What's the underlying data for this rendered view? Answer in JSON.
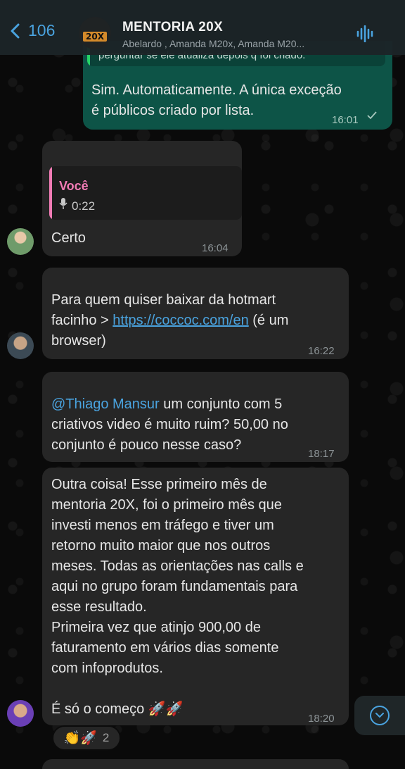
{
  "header": {
    "back_count": "106",
    "group_badge": "20X",
    "title": "MENTORIA 20X",
    "subtitle": "Abelardo , Amanda M20x, Amanda M20..."
  },
  "messages": {
    "reply_snippet": "perguntar se ele atualiza depois q foi criado.",
    "m1_text": "Sim. Automaticamente. A única exceção\né públicos criado por lista.",
    "m1_time": "16:01",
    "m2_quote_author": "Você",
    "m2_quote_duration": "0:22",
    "m2_text": "Certo",
    "m2_time": "16:04",
    "m3_text_before": "Para quem quiser baixar da hotmart\nfacinho > ",
    "m3_link": "https://coccoc.com/en",
    "m3_text_after": " (é um\nbrowser)",
    "m3_time": "16:22",
    "m4_mention": "@Thiago Mansur",
    "m4_text": " um conjunto com 5\ncriativos video é muito ruim? 50,00 no\nconjunto é pouco nesse caso?",
    "m4_time": "18:17",
    "m5_text": "Outra coisa! Esse primeiro mês de\nmentoria 20X, foi o primeiro mês que\ninvesti menos em tráfego e tiver um\nretorno muito maior que nos outros\nmeses. Todas as orientações nas calls e\naqui no grupo foram fundamentais para\nesse resultado.\nPrimeira vez que atinjo 900,00 de\nfaturamento em vários dias somente\ncom infoprodutos.\n\nÉ só o começo 🚀🚀",
    "m5_time": "18:20"
  },
  "reactions": {
    "emojis": "👏🚀",
    "count": "2"
  },
  "colors": {
    "accent": "#4aa3df",
    "outgoing_bubble": "#0d5447",
    "incoming_bubble": "#262626",
    "quote_accent": "#f27bb5"
  }
}
